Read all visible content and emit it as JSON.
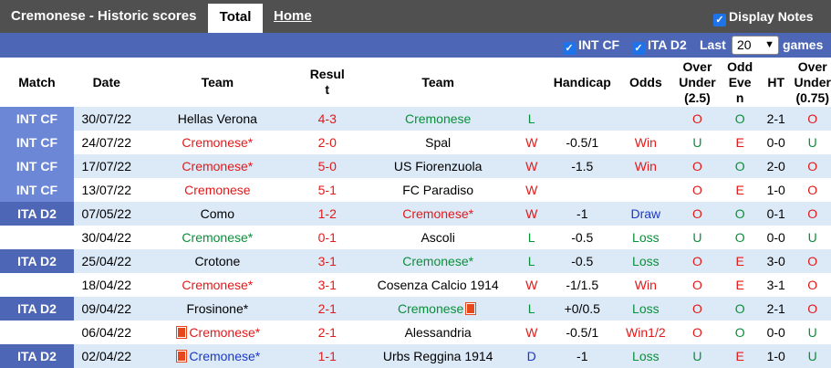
{
  "header": {
    "title": "Cremonese - Historic scores",
    "tab_total": "Total",
    "tab_home": "Home",
    "display_notes": "Display Notes"
  },
  "filters": {
    "int_cf": "INT CF",
    "ita_d2": "ITA D2",
    "last_label": "Last",
    "last_value": "20",
    "games_label": "games"
  },
  "columns": [
    "Match",
    "Date",
    "Team",
    "Result",
    "Team",
    "",
    "Handicap",
    "Odds",
    "Over Under (2.5)",
    "Odd Even",
    "HT",
    "Over Under (0.75)"
  ],
  "columns_display": {
    "match": "Match",
    "date": "Date",
    "team_home": "Team",
    "result_a": "Resul",
    "result_b": "t",
    "team_away": "Team",
    "handicap": "Handicap",
    "odds": "Odds",
    "ou_a": "Over",
    "ou_b": "Under",
    "ou_c": "(2.5)",
    "oe_a": "Odd",
    "oe_b": "Eve",
    "oe_c": "n",
    "ht": "HT",
    "ou2_a": "Over",
    "ou2_b": "Under",
    "ou2_c": "(0.75)"
  },
  "rows": [
    {
      "league": "INT CF",
      "date": "30/07/22",
      "home": "Hellas Verona",
      "home_color": "black",
      "home_mark": false,
      "score": "4-3",
      "away": "Cremonese",
      "away_color": "green",
      "away_mark": false,
      "wl": "L",
      "wl_color": "green",
      "handicap": "",
      "odds": "",
      "odds_color": "",
      "ou": "O",
      "ou_color": "red",
      "oe": "O",
      "oe_color": "green",
      "ht": "2-1",
      "ou2": "O",
      "ou2_color": "red"
    },
    {
      "league": "INT CF",
      "date": "24/07/22",
      "home": "Cremonese*",
      "home_color": "red",
      "home_mark": false,
      "score": "2-0",
      "away": "Spal",
      "away_color": "black",
      "away_mark": false,
      "wl": "W",
      "wl_color": "red",
      "handicap": "-0.5/1",
      "odds": "Win",
      "odds_color": "red",
      "ou": "U",
      "ou_color": "green",
      "oe": "E",
      "oe_color": "red",
      "ht": "0-0",
      "ou2": "U",
      "ou2_color": "green"
    },
    {
      "league": "INT CF",
      "date": "17/07/22",
      "home": "Cremonese*",
      "home_color": "red",
      "home_mark": false,
      "score": "5-0",
      "away": "US Fiorenzuola",
      "away_color": "black",
      "away_mark": false,
      "wl": "W",
      "wl_color": "red",
      "handicap": "-1.5",
      "odds": "Win",
      "odds_color": "red",
      "ou": "O",
      "ou_color": "red",
      "oe": "O",
      "oe_color": "green",
      "ht": "2-0",
      "ou2": "O",
      "ou2_color": "red"
    },
    {
      "league": "INT CF",
      "date": "13/07/22",
      "home": "Cremonese",
      "home_color": "red",
      "home_mark": false,
      "score": "5-1",
      "away": "FC Paradiso",
      "away_color": "black",
      "away_mark": false,
      "wl": "W",
      "wl_color": "red",
      "handicap": "",
      "odds": "",
      "odds_color": "",
      "ou": "O",
      "ou_color": "red",
      "oe": "E",
      "oe_color": "red",
      "ht": "1-0",
      "ou2": "O",
      "ou2_color": "red"
    },
    {
      "league": "ITA D2",
      "date": "07/05/22",
      "home": "Como",
      "home_color": "black",
      "home_mark": false,
      "score": "1-2",
      "away": "Cremonese*",
      "away_color": "red",
      "away_mark": false,
      "wl": "W",
      "wl_color": "red",
      "handicap": "-1",
      "odds": "Draw",
      "odds_color": "blue",
      "ou": "O",
      "ou_color": "red",
      "oe": "O",
      "oe_color": "green",
      "ht": "0-1",
      "ou2": "O",
      "ou2_color": "red"
    },
    {
      "league": "ITA D2",
      "date": "30/04/22",
      "home": "Cremonese*",
      "home_color": "green",
      "home_mark": false,
      "score": "0-1",
      "away": "Ascoli",
      "away_color": "black",
      "away_mark": false,
      "wl": "L",
      "wl_color": "green",
      "handicap": "-0.5",
      "odds": "Loss",
      "odds_color": "green",
      "ou": "U",
      "ou_color": "green",
      "oe": "O",
      "oe_color": "green",
      "ht": "0-0",
      "ou2": "U",
      "ou2_color": "green"
    },
    {
      "league": "ITA D2",
      "date": "25/04/22",
      "home": "Crotone",
      "home_color": "black",
      "home_mark": false,
      "score": "3-1",
      "away": "Cremonese*",
      "away_color": "green",
      "away_mark": false,
      "wl": "L",
      "wl_color": "green",
      "handicap": "-0.5",
      "odds": "Loss",
      "odds_color": "green",
      "ou": "O",
      "ou_color": "red",
      "oe": "E",
      "oe_color": "red",
      "ht": "3-0",
      "ou2": "O",
      "ou2_color": "red"
    },
    {
      "league": "ITA D2",
      "date": "18/04/22",
      "home": "Cremonese*",
      "home_color": "red",
      "home_mark": false,
      "score": "3-1",
      "away": "Cosenza Calcio 1914",
      "away_color": "black",
      "away_mark": false,
      "wl": "W",
      "wl_color": "red",
      "handicap": "-1/1.5",
      "odds": "Win",
      "odds_color": "red",
      "ou": "O",
      "ou_color": "red",
      "oe": "E",
      "oe_color": "red",
      "ht": "3-1",
      "ou2": "O",
      "ou2_color": "red"
    },
    {
      "league": "ITA D2",
      "date": "09/04/22",
      "home": "Frosinone*",
      "home_color": "black",
      "home_mark": false,
      "score": "2-1",
      "away": "Cremonese",
      "away_color": "green",
      "away_mark": true,
      "wl": "L",
      "wl_color": "green",
      "handicap": "+0/0.5",
      "odds": "Loss",
      "odds_color": "green",
      "ou": "O",
      "ou_color": "red",
      "oe": "O",
      "oe_color": "green",
      "ht": "2-1",
      "ou2": "O",
      "ou2_color": "red"
    },
    {
      "league": "ITA D2",
      "date": "06/04/22",
      "home": "Cremonese*",
      "home_color": "red",
      "home_mark": true,
      "score": "2-1",
      "away": "Alessandria",
      "away_color": "black",
      "away_mark": false,
      "wl": "W",
      "wl_color": "red",
      "handicap": "-0.5/1",
      "odds": "Win1/2",
      "odds_color": "red",
      "ou": "O",
      "ou_color": "red",
      "oe": "O",
      "oe_color": "green",
      "ht": "0-0",
      "ou2": "U",
      "ou2_color": "green"
    },
    {
      "league": "ITA D2",
      "date": "02/04/22",
      "home": "Cremonese*",
      "home_color": "blue",
      "home_mark": true,
      "score": "1-1",
      "away": "Urbs Reggina 1914",
      "away_color": "black",
      "away_mark": false,
      "wl": "D",
      "wl_color": "blue",
      "handicap": "-1",
      "odds": "Loss",
      "odds_color": "green",
      "ou": "U",
      "ou_color": "green",
      "oe": "E",
      "oe_color": "red",
      "ht": "1-0",
      "ou2": "U",
      "ou2_color": "green"
    }
  ],
  "colors": {
    "header_bg": "#505050",
    "filter_bg": "#4d66b5",
    "int_cf_bg": "#6b87d6",
    "ita_d2_bg": "#4d66b5",
    "row_alt_bg": "#dce9f7",
    "red": "#e21a1a",
    "green": "#0a8f3a",
    "blue": "#1c39c4"
  }
}
